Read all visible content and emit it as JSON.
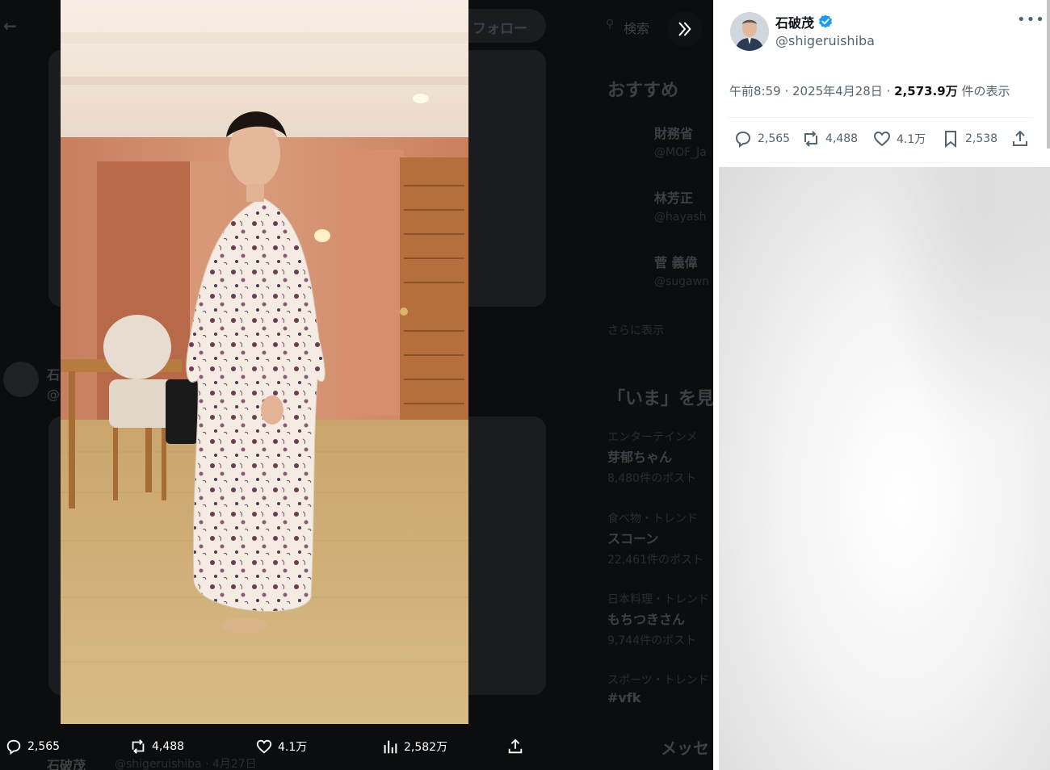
{
  "background_ui": {
    "follow_label": "フォロー",
    "search_placeholder": "検索",
    "section_recommend": "おすすめ",
    "accounts": [
      {
        "name": "財務省",
        "handle": "@MOF_Ja"
      },
      {
        "name": "林芳正",
        "handle": "@hayash"
      },
      {
        "name": "菅 義偉",
        "handle": "@sugawn"
      }
    ],
    "show_more": "さらに表示",
    "section_now": "「いま」を見",
    "trends": [
      {
        "category": "エンターテインメ",
        "title": "芽郁ちゃん",
        "posts": "8,480件のポスト"
      },
      {
        "category": "食べ物・トレンド",
        "title": "スコーン",
        "posts": "22,461件のポスト"
      },
      {
        "category": "日本料理・トレンド",
        "title": "もちつきさん",
        "posts": "9,744件のポスト"
      },
      {
        "category": "スポーツ・トレンド",
        "title": "#vfk",
        "posts": ""
      }
    ],
    "messages": "メッセ",
    "bottom_author": "石破茂",
    "bottom_handle": "@shigeruishiba · 4月27日",
    "mid_author_initial": "石",
    "mid_author_sub": "@"
  },
  "media_stats": {
    "replies": "2,565",
    "reposts": "4,488",
    "likes": "4.1万",
    "views": "2,582万"
  },
  "post": {
    "author_name": "石破茂",
    "author_handle": "@shigeruishiba",
    "time": "午前8:59",
    "date": "2025年4月28日",
    "views_number": "2,573.9万",
    "views_suffix": "件の表示",
    "replies": "2,565",
    "reposts": "4,488",
    "likes": "4.1万",
    "bookmarks": "2,538",
    "verified_color": "#1d9bf0"
  }
}
